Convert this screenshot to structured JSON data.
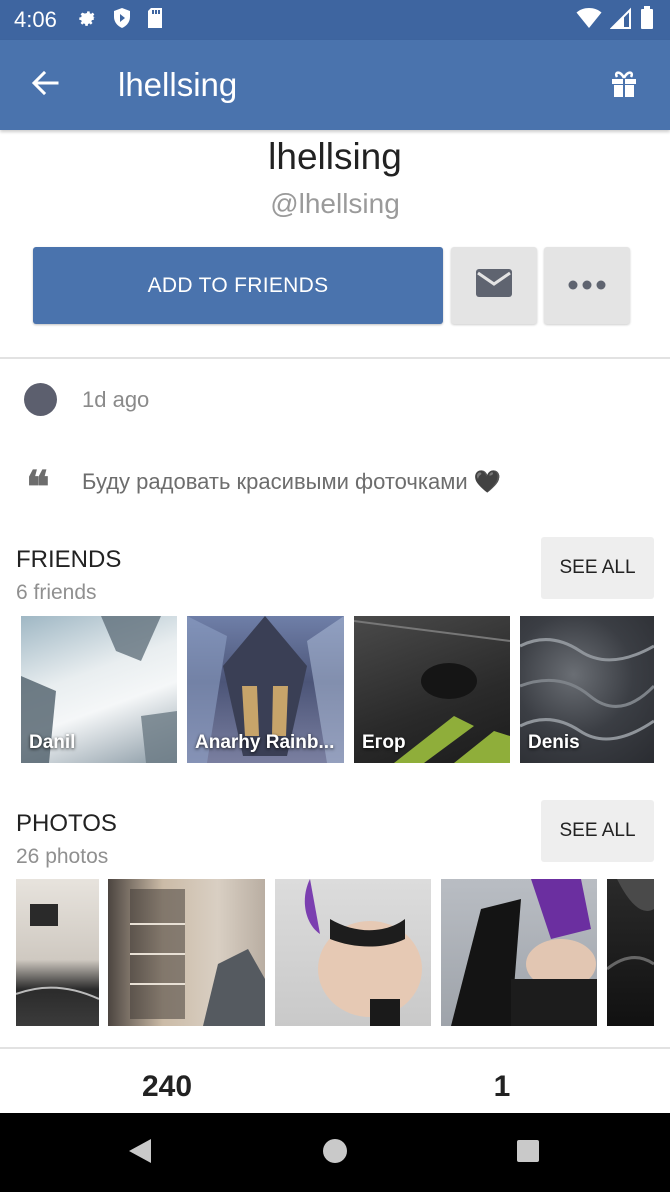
{
  "status_bar": {
    "time": "4:06",
    "icons_left": [
      "gear-icon",
      "shield-icon",
      "sd-card-icon"
    ],
    "icons_right": [
      "wifi-icon",
      "cellular-signal-icon",
      "battery-icon"
    ]
  },
  "app_bar": {
    "title": "lhellsing",
    "back_icon": "arrow-back-icon",
    "gift_icon": "gift-icon"
  },
  "profile": {
    "name": "lhellsing",
    "handle": "@lhellsing",
    "add_friends_label": "ADD TO FRIENDS",
    "message_icon": "envelope-icon",
    "more_icon": "more-dots-icon",
    "last_seen": "1d ago",
    "status_text": "Буду радовать красивыми фоточками",
    "status_emoji": "🖤"
  },
  "friends": {
    "title": "FRIENDS",
    "count": "6 friends",
    "see_all": "SEE ALL",
    "items": [
      {
        "name": "Danil"
      },
      {
        "name": "Anarhy Rainb..."
      },
      {
        "name": "Егор"
      },
      {
        "name": "Denis"
      }
    ]
  },
  "photos": {
    "title": "PHOTOS",
    "count": "26 photos",
    "see_all": "SEE ALL"
  },
  "stats": {
    "left": "240",
    "right": "1"
  },
  "colors": {
    "accent": "#4a73ad",
    "status_bar": "#3e65a0",
    "button_gray": "#e4e4e4"
  },
  "nav_bar": {
    "icons": [
      "back-triangle-icon",
      "home-circle-icon",
      "recents-square-icon"
    ]
  }
}
